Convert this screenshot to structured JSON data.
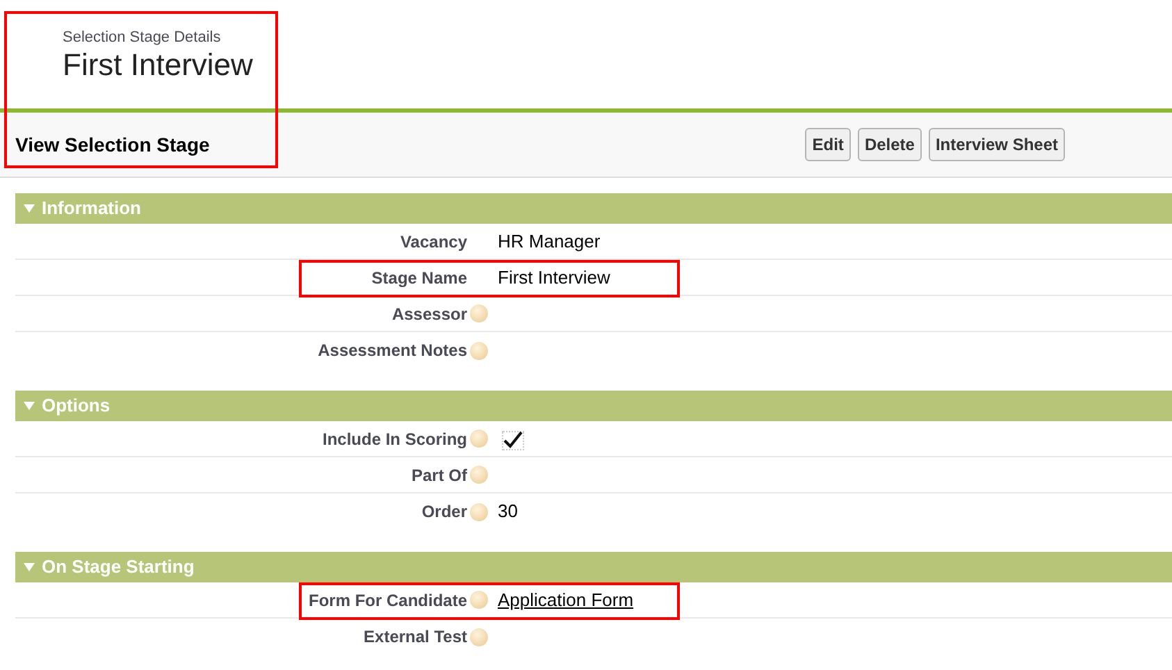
{
  "header": {
    "subtitle": "Selection Stage Details",
    "title": "First Interview",
    "highlighted": true
  },
  "toolbar": {
    "title": "View Selection Stage",
    "buttons": [
      "Edit",
      "Delete",
      "Interview Sheet"
    ]
  },
  "sections": [
    {
      "title": "Information",
      "expanded": true,
      "rows": [
        {
          "label": "Vacancy",
          "help": false,
          "kind": "text",
          "value": "HR Manager",
          "highlighted": false
        },
        {
          "label": "Stage Name",
          "help": false,
          "kind": "text",
          "value": "First Interview",
          "highlighted": true
        },
        {
          "label": "Assessor",
          "help": true,
          "kind": "text",
          "highlighted": false
        },
        {
          "label": "Assessment Notes",
          "help": true,
          "kind": "text",
          "highlighted": false
        }
      ]
    },
    {
      "title": "Options",
      "expanded": true,
      "rows": [
        {
          "label": "Include In Scoring",
          "help": true,
          "kind": "checkbox",
          "checked": true,
          "highlighted": false
        },
        {
          "label": "Part Of",
          "help": true,
          "kind": "text",
          "highlighted": false
        },
        {
          "label": "Order",
          "help": true,
          "kind": "text",
          "value": "30",
          "highlighted": false
        }
      ]
    },
    {
      "title": "On Stage Starting",
      "expanded": true,
      "rows": [
        {
          "label": "Form For Candidate",
          "help": true,
          "kind": "link",
          "value": "Application Form",
          "highlighted": true
        },
        {
          "label": "External Test",
          "help": true,
          "kind": "text",
          "highlighted": false
        }
      ]
    }
  ]
}
